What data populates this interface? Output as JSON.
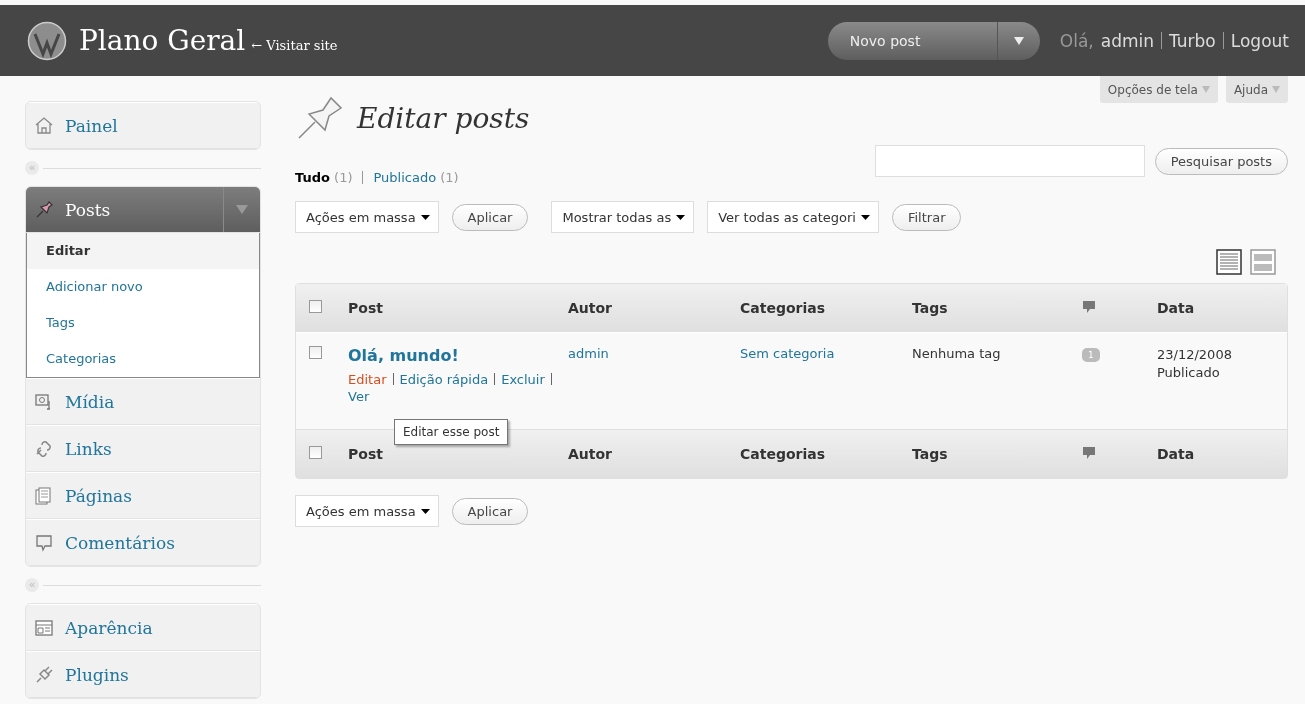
{
  "header": {
    "site_title": "Plano Geral",
    "visit_link": "← Visitar site",
    "new_post_button": "Novo post",
    "greeting": "Olá,",
    "user": "admin",
    "links": [
      "Turbo",
      "Logout"
    ]
  },
  "screen_tabs": [
    "Opções de tela",
    "Ajuda"
  ],
  "sidebar": {
    "groups": [
      {
        "items": [
          {
            "label": "Painel",
            "expanded": false
          }
        ]
      },
      {
        "collapse_toggle": "«",
        "items": [
          {
            "label": "Posts",
            "expanded": true,
            "children": [
              {
                "label": "Editar",
                "selected": true
              },
              {
                "label": "Adicionar novo",
                "selected": false
              },
              {
                "label": "Tags",
                "selected": false
              },
              {
                "label": "Categorias",
                "selected": false
              }
            ]
          },
          {
            "label": "Mídia",
            "expanded": false
          },
          {
            "label": "Links",
            "expanded": false
          },
          {
            "label": "Páginas",
            "expanded": false
          },
          {
            "label": "Comentários",
            "expanded": false
          }
        ]
      },
      {
        "collapse_toggle": "«",
        "items": [
          {
            "label": "Aparência",
            "expanded": false
          },
          {
            "label": "Plugins",
            "expanded": false
          }
        ]
      }
    ]
  },
  "page_title": "Editar posts",
  "search": {
    "button": "Pesquisar posts"
  },
  "filters": [
    {
      "label": "Tudo",
      "count": "(1)",
      "selected": true
    },
    {
      "label": "Publicado",
      "count": "(1)",
      "selected": false
    }
  ],
  "toolbar": [
    {
      "kind": "select",
      "label": "Ações em massa"
    },
    {
      "kind": "button",
      "label": "Aplicar"
    },
    {
      "kind": "select",
      "label": "Mostrar todas as"
    },
    {
      "kind": "select",
      "label": "Ver todas as categori"
    },
    {
      "kind": "button",
      "label": "Filtrar"
    }
  ],
  "view_modes": [
    {
      "selected": true
    },
    {
      "selected": false
    }
  ],
  "table": {
    "columns": [
      {
        "kind": "checkbox",
        "checked": false
      },
      {
        "kind": "text",
        "label": "Post"
      },
      {
        "kind": "text",
        "label": "Autor"
      },
      {
        "kind": "text",
        "label": "Categorias"
      },
      {
        "kind": "text",
        "label": "Tags"
      },
      {
        "kind": "comments"
      },
      {
        "kind": "text",
        "label": "Data"
      }
    ],
    "rows": [
      {
        "checked": false,
        "title": "Olá, mundo!",
        "actions": [
          {
            "label": "Editar",
            "hover": true
          },
          {
            "label": "Edição rápida",
            "hover": false
          },
          {
            "label": "Excluir",
            "hover": false
          },
          {
            "label": "Ver",
            "hover": false
          }
        ],
        "author": "admin",
        "category": "Sem categoria",
        "tags": "Nenhuma tag",
        "comments": "1",
        "date": "23/12/2008",
        "status": "Publicado"
      }
    ],
    "footer_columns": [
      {
        "kind": "checkbox",
        "checked": false
      },
      {
        "kind": "text",
        "label": "Post"
      },
      {
        "kind": "text",
        "label": "Autor"
      },
      {
        "kind": "text",
        "label": "Categorias"
      },
      {
        "kind": "text",
        "label": "Tags"
      },
      {
        "kind": "comments"
      },
      {
        "kind": "text",
        "label": "Data"
      }
    ]
  },
  "tooltip": "Editar esse post",
  "bottom_toolbar": [
    {
      "kind": "select",
      "label": "Ações em massa"
    },
    {
      "kind": "button",
      "label": "Aplicar"
    }
  ]
}
